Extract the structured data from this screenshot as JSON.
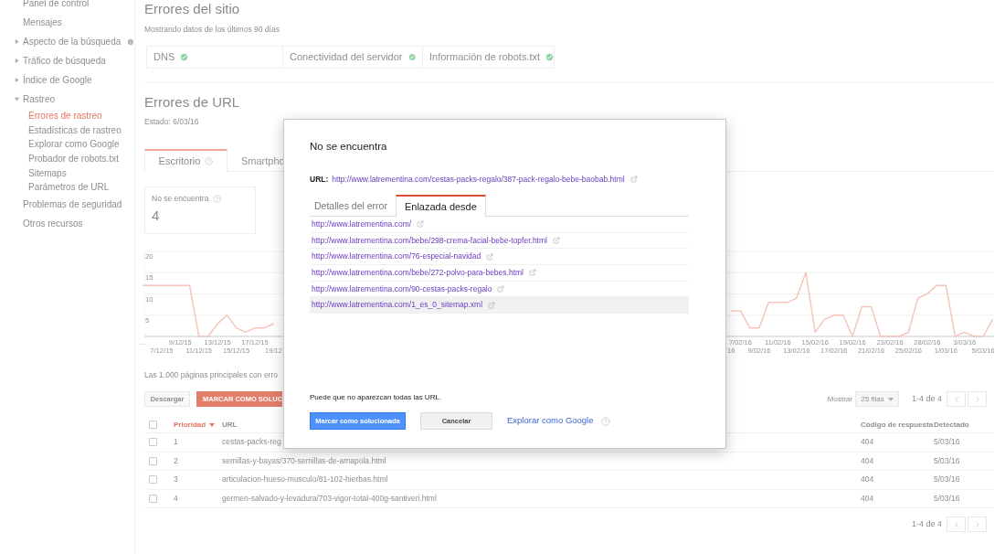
{
  "sidebar": {
    "items": [
      {
        "kind": "link",
        "label": "Panel de control"
      },
      {
        "kind": "link",
        "label": "Mensajes"
      },
      {
        "kind": "group",
        "label": "Aspecto de la búsqueda",
        "expanded": false,
        "info": true
      },
      {
        "kind": "group",
        "label": "Tráfico de búsqueda",
        "expanded": false,
        "info": false
      },
      {
        "kind": "group",
        "label": "Índice de Google",
        "expanded": false,
        "info": false
      },
      {
        "kind": "group",
        "label": "Rastreo",
        "expanded": true,
        "info": false,
        "children": [
          {
            "label": "Errores de rastreo",
            "selected": true
          },
          {
            "label": "Estadísticas de rastreo",
            "selected": false
          },
          {
            "label": "Explorar como Google",
            "selected": false
          },
          {
            "label": "Probador de robots.txt",
            "selected": false
          },
          {
            "label": "Sitemaps",
            "selected": false
          },
          {
            "label": "Parámetros de URL",
            "selected": false
          }
        ]
      },
      {
        "kind": "link",
        "label": "Problemas de seguridad"
      },
      {
        "kind": "link",
        "label": "Otros recursos"
      }
    ]
  },
  "site_errors": {
    "title": "Errores del sitio",
    "subtitle": "Mostrando datos de los últimos 90 días",
    "checks": [
      {
        "label": "DNS",
        "ok": true
      },
      {
        "label": "Conectividad del servidor",
        "ok": true
      },
      {
        "label": "Información de robots.txt",
        "ok": true
      }
    ]
  },
  "url_errors": {
    "title": "Errores de URL",
    "status": "Estado: 6/03/16",
    "tabs": [
      {
        "label": "Escritorio",
        "selected": true,
        "help": true
      },
      {
        "label": "Smartpho",
        "selected": false,
        "help": false
      }
    ],
    "summary": {
      "label": "No se encuentra",
      "count": "4",
      "help": true
    },
    "chart_data": {
      "type": "line",
      "grid": true,
      "ylim": [
        0,
        20
      ],
      "yticks": [
        5,
        10,
        15,
        20
      ],
      "categories": [
        "…",
        null,
        "7/12/15",
        null,
        "9/12/15",
        null,
        "11/12/15",
        null,
        "13/12/15",
        null,
        "15/12/15",
        null,
        "17/12/15",
        null,
        "19/12",
        null,
        null,
        null,
        null,
        null,
        null,
        null,
        null,
        null,
        null,
        null,
        null,
        null,
        null,
        null,
        null,
        null,
        null,
        null,
        null,
        null,
        null,
        null,
        null,
        null,
        null,
        null,
        null,
        null,
        null,
        null,
        null,
        null,
        null,
        null,
        null,
        null,
        null,
        null,
        null,
        null,
        null,
        null,
        null,
        null,
        null,
        null,
        null,
        "16",
        "7/02/16",
        null,
        "9/02/16",
        null,
        "11/02/16",
        null,
        "13/02/16",
        null,
        "15/02/16",
        null,
        "17/02/16",
        null,
        "19/02/16",
        null,
        "21/02/16",
        null,
        "23/02/16",
        null,
        "25/02/16",
        null,
        "28/02/16",
        null,
        "1/03/16",
        null,
        "3/03/16",
        null,
        "5/03/16",
        null
      ],
      "series": [
        {
          "color": "#f5c3b7",
          "values": [
            12,
            12,
            12,
            12,
            12,
            12,
            0,
            0,
            3,
            5,
            2,
            1,
            2,
            2,
            3,
            null,
            null,
            null,
            null,
            null,
            null,
            null,
            null,
            null,
            null,
            null,
            null,
            null,
            null,
            null,
            null,
            null,
            null,
            null,
            null,
            null,
            null,
            null,
            null,
            null,
            null,
            null,
            null,
            null,
            null,
            null,
            null,
            null,
            null,
            null,
            null,
            null,
            null,
            null,
            null,
            null,
            null,
            null,
            null,
            null,
            null,
            null,
            null,
            6,
            6,
            2,
            2,
            8,
            8,
            8,
            9,
            15,
            1,
            4,
            5,
            5,
            0,
            7,
            7,
            0,
            0,
            0,
            1,
            9,
            10,
            12,
            12,
            0,
            1,
            0,
            0,
            4
          ]
        }
      ]
    },
    "caption": "Las 1.000 páginas principales con erro",
    "actions": [
      {
        "kind": "secondary",
        "label": "Descargar"
      },
      {
        "kind": "primary",
        "label": "MARCAR COMO SOLUC"
      }
    ],
    "pager": {
      "show_label": "Mostrar",
      "rows_option": "25 filas",
      "range": "1-4 de 4"
    },
    "table": {
      "select_all_checked": false,
      "columns": [
        {
          "label": "Prioridad",
          "sorted": true
        },
        {
          "label": "URL",
          "sorted": false
        },
        {
          "label": "Código de respuesta",
          "sorted": false
        },
        {
          "label": "Detectado",
          "sorted": false
        }
      ],
      "rows": [
        {
          "checked": false,
          "cells": [
            "1",
            "cestas-packs-reg",
            "404",
            "5/03/16"
          ]
        },
        {
          "checked": false,
          "cells": [
            "2",
            "semillas-y-bayas/370-semillas-de-amapola.html",
            "404",
            "5/03/16"
          ]
        },
        {
          "checked": false,
          "cells": [
            "3",
            "articulacion-hueso-musculo/81-102-hierbas.html",
            "404",
            "5/03/16"
          ]
        },
        {
          "checked": false,
          "cells": [
            "4",
            "germen-salvado-y-levadura/703-vigor-total-400g-santiveri.html",
            "404",
            "5/03/16"
          ]
        }
      ]
    },
    "footer_pager": {
      "range": "1-4 de 4"
    }
  },
  "dialog": {
    "title": "No se encuentra",
    "url_label": "URL:",
    "url": "http://www.latrementina.com/cestas-packs-regalo/387-pack-regalo-bebe-baobab.html",
    "tabs": [
      {
        "label": "Detalles del error",
        "selected": false
      },
      {
        "label": "Enlazada desde",
        "selected": true
      }
    ],
    "links": [
      {
        "url": "http://www.latrementina.com/",
        "highlighted": false
      },
      {
        "url": "http://www.latrementina.com/bebe/298-crema-facial-bebe-topfer.html",
        "highlighted": false
      },
      {
        "url": "http://www.latrementina.com/76-especial-navidad",
        "highlighted": false
      },
      {
        "url": "http://www.latrementina.com/bebe/272-polvo-para-bebes.html",
        "highlighted": false
      },
      {
        "url": "http://www.latrementina.com/90-cestas-packs-regalo",
        "highlighted": false
      },
      {
        "url": "http://www.latrementina.com/1_es_0_sitemap.xml",
        "highlighted": true
      }
    ],
    "note": "Puede que no aparezcan todas las URL.",
    "buttons": [
      {
        "kind": "primary",
        "label": "Marcar como solucionada"
      },
      {
        "kind": "secondary",
        "label": "Cancelar"
      },
      {
        "kind": "link",
        "label": "Explorar como Google",
        "help": true
      }
    ]
  }
}
